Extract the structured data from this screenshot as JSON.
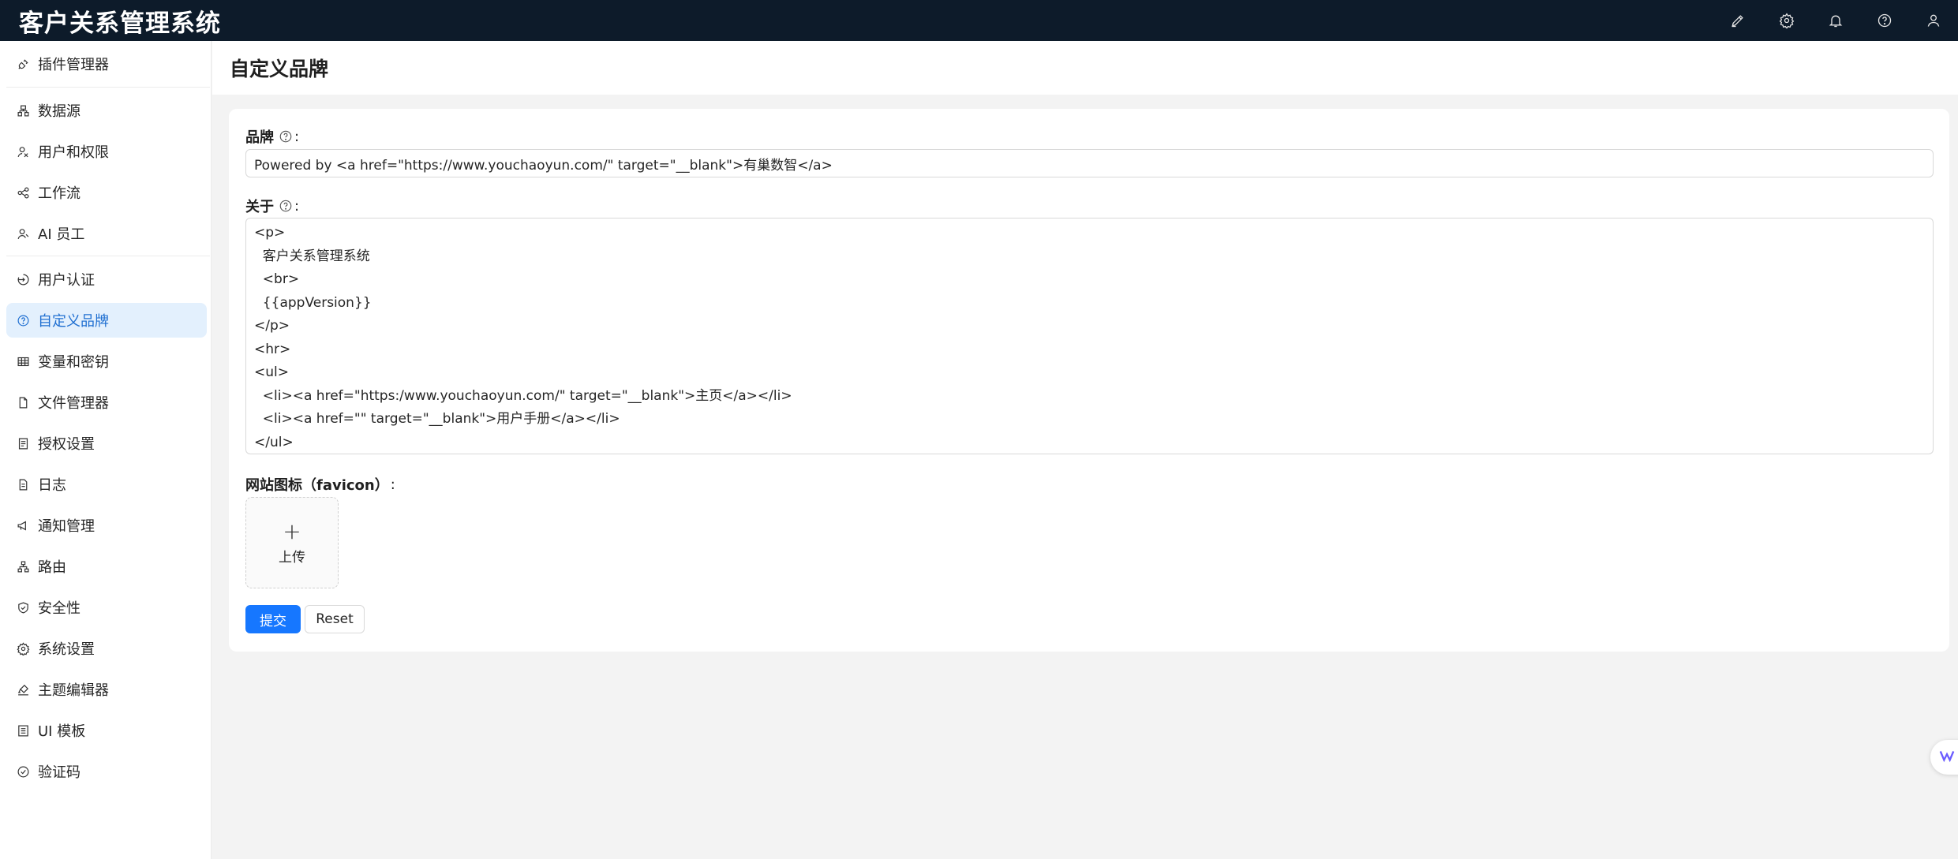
{
  "app": {
    "title": "客户关系管理系统"
  },
  "topbar": {
    "icons": [
      "pen-icon",
      "gear-icon",
      "bell-icon",
      "help-circle-icon",
      "user-icon"
    ]
  },
  "sidebar": {
    "items": [
      {
        "label": "插件管理器",
        "icon": "plug-icon"
      },
      {
        "label": "数据源",
        "icon": "database-tree-icon"
      },
      {
        "label": "用户和权限",
        "icon": "users-icon"
      },
      {
        "label": "工作流",
        "icon": "workflow-icon"
      },
      {
        "label": "AI 员工",
        "icon": "ai-users-icon"
      },
      {
        "label": "用户认证",
        "icon": "login-icon"
      },
      {
        "label": "自定义品牌",
        "icon": "help-circle-icon",
        "active": true
      },
      {
        "label": "变量和密钥",
        "icon": "table-icon"
      },
      {
        "label": "文件管理器",
        "icon": "file-icon"
      },
      {
        "label": "授权设置",
        "icon": "license-icon"
      },
      {
        "label": "日志",
        "icon": "log-icon"
      },
      {
        "label": "通知管理",
        "icon": "megaphone-icon"
      },
      {
        "label": "路由",
        "icon": "route-icon"
      },
      {
        "label": "安全性",
        "icon": "shield-icon"
      },
      {
        "label": "系统设置",
        "icon": "gear-icon"
      },
      {
        "label": "主题编辑器",
        "icon": "brush-icon"
      },
      {
        "label": "UI 模板",
        "icon": "template-icon"
      },
      {
        "label": "验证码",
        "icon": "check-circle-icon"
      }
    ]
  },
  "page": {
    "title": "自定义品牌"
  },
  "form": {
    "brand_label": "品牌",
    "brand_value": "Powered by <a href=\"https://www.youchaoyun.com/\" target=\"__blank\">有巢数智</a>",
    "about_label": "关于",
    "about_lines": [
      "<p>",
      "  客户关系管理系统",
      "  <br>",
      "  {{appVersion}}",
      "</p>",
      "<hr>",
      "<ul>",
      "  <li><a href=\"https:/www.youchaoyun.com/\" target=\"__blank\">主页</a></li>",
      "  <li><a href=\"\" target=\"__blank\">用户手册</a></li>",
      "</ul>"
    ],
    "favicon_label": "网站图标（favicon）",
    "upload_label": "上传",
    "submit_label": "提交",
    "reset_label": "Reset"
  },
  "colors": {
    "topbar_bg": "#0d1b2a",
    "primary": "#1677ff",
    "active_bg": "#e3f0fd",
    "active_text": "#1f6fd1"
  }
}
